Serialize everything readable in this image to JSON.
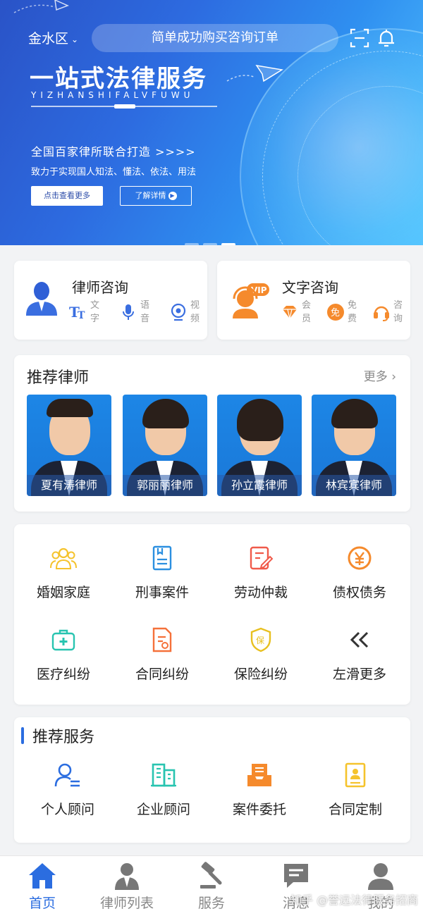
{
  "header": {
    "district": "金水区",
    "notice": "简单成功购买咨询订单"
  },
  "banner": {
    "title": "一站式法律服务",
    "pinyin": "YIZHANSHIFALVFUWU",
    "subtitle": "全国百家律所联合打造 >>>>",
    "desc": "致力于实现国人知法、懂法、依法、用法",
    "btn_more": "点击查看更多",
    "btn_detail": "了解详情",
    "slide_count": 3,
    "active_slide": 3
  },
  "consult": {
    "lawyer": {
      "title": "律师咨询",
      "options": [
        {
          "label": "文字",
          "icon": "text-icon"
        },
        {
          "label": "语音",
          "icon": "microphone-icon"
        },
        {
          "label": "视频",
          "icon": "video-icon"
        }
      ]
    },
    "text": {
      "title": "文字咨询",
      "badge": "VIP",
      "options": [
        {
          "label": "会员",
          "icon": "diamond-icon"
        },
        {
          "label": "免费",
          "icon": "free-badge-icon",
          "badge": "免"
        },
        {
          "label": "咨询",
          "icon": "headset-icon"
        }
      ]
    }
  },
  "lawyers": {
    "title": "推荐律师",
    "more": "更多",
    "items": [
      {
        "name": "夏有涛律师"
      },
      {
        "name": "郭丽丽律师"
      },
      {
        "name": "孙立霞律师"
      },
      {
        "name": "林宾宾律师"
      }
    ]
  },
  "categories": [
    {
      "label": "婚姻家庭",
      "icon": "family-icon",
      "color": "#f5c32c"
    },
    {
      "label": "刑事案件",
      "icon": "document-icon",
      "color": "#2b8fe0"
    },
    {
      "label": "劳动仲裁",
      "icon": "edit-document-icon",
      "color": "#f05a4a"
    },
    {
      "label": "债权债务",
      "icon": "yen-icon",
      "color": "#f58a2c"
    },
    {
      "label": "医疗纠纷",
      "icon": "medical-kit-icon",
      "color": "#28c4b0"
    },
    {
      "label": "合同纠纷",
      "icon": "contract-icon",
      "color": "#f5713a"
    },
    {
      "label": "保险纠纷",
      "icon": "shield-icon",
      "color": "#e8c020"
    },
    {
      "label": "左滑更多",
      "icon": "double-chevron-left-icon",
      "color": "#333333"
    }
  ],
  "services": {
    "title": "推荐服务",
    "items": [
      {
        "label": "个人顾问",
        "icon": "person-icon",
        "color": "#2b6de0"
      },
      {
        "label": "企业顾问",
        "icon": "building-icon",
        "color": "#28c4b0"
      },
      {
        "label": "案件委托",
        "icon": "inbox-icon",
        "color": "#f58a2c"
      },
      {
        "label": "合同定制",
        "icon": "contract-person-icon",
        "color": "#f5c32c"
      }
    ]
  },
  "nav": [
    {
      "label": "首页",
      "icon": "home-icon",
      "active": true
    },
    {
      "label": "律师列表",
      "icon": "lawyer-icon",
      "active": false
    },
    {
      "label": "服务",
      "icon": "gavel-icon",
      "active": false
    },
    {
      "label": "消息",
      "icon": "message-icon",
      "active": false
    },
    {
      "label": "我的",
      "icon": "user-icon",
      "active": false
    }
  ],
  "watermark": "知乎 @誉远法律服务招商",
  "colors": {
    "accent": "#2b6de0",
    "banner_start": "#2a53c7",
    "banner_end": "#52c4ff"
  }
}
